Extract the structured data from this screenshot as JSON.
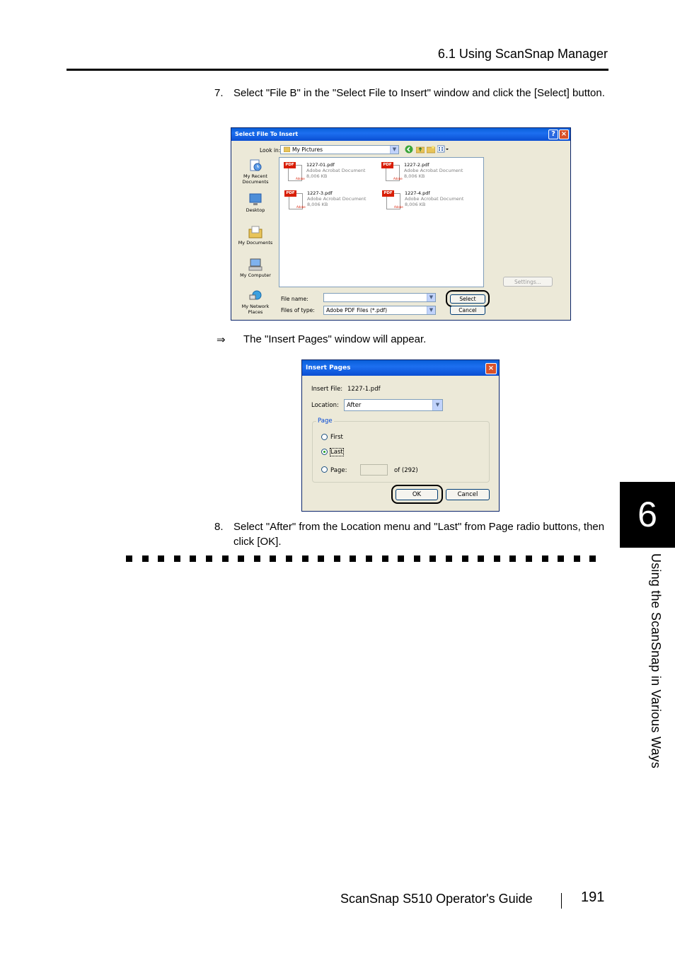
{
  "header": {
    "section_title": "6.1 Using ScanSnap Manager"
  },
  "step7": {
    "number": "7.",
    "text": "Select \"File B\" in the \"Select File to Insert\" window and click the [Select] button."
  },
  "select_dialog": {
    "title": "Select File To Insert",
    "look_in_label": "Look in:",
    "look_in_value": "My Pictures",
    "places": [
      "My Recent Documents",
      "Desktop",
      "My Documents",
      "My Computer",
      "My Network Places"
    ],
    "files": [
      {
        "name": "1227-01.pdf",
        "type": "Adobe Acrobat Document",
        "size": "8,006 KB"
      },
      {
        "name": "1227-2.pdf",
        "type": "Adobe Acrobat Document",
        "size": "8,006 KB"
      },
      {
        "name": "1227-3.pdf",
        "type": "Adobe Acrobat Document",
        "size": "8,006 KB"
      },
      {
        "name": "1227-4.pdf",
        "type": "Adobe Acrobat Document",
        "size": "8,006 KB"
      }
    ],
    "settings_label": "Settings...",
    "file_name_label": "File name:",
    "file_name_value": "",
    "files_of_type_label": "Files of type:",
    "files_of_type_value": "Adobe PDF Files (*.pdf)",
    "select_label": "Select",
    "cancel_label": "Cancel"
  },
  "arrow_note": {
    "arrow": "⇒",
    "text": "The \"Insert Pages\" window will appear."
  },
  "insert_dialog": {
    "title": "Insert Pages",
    "insert_file_label": "Insert File:",
    "insert_file_value": "1227-1.pdf",
    "location_label": "Location:",
    "location_value": "After",
    "page_group_label": "Page",
    "first_label": "First",
    "last_label": "Last",
    "page_label": "Page:",
    "page_value": "",
    "of_text": "of  (292)",
    "ok_label": "OK",
    "cancel_label": "Cancel"
  },
  "step8": {
    "number": "8.",
    "text": "Select \"After\" from the Location menu and \"Last\" from Page radio buttons, then click [OK]."
  },
  "chapter": {
    "number": "6",
    "title": "Using the ScanSnap in Various Ways"
  },
  "footer": {
    "guide_title": "ScanSnap  S510 Operator's Guide",
    "page_number": "191"
  }
}
